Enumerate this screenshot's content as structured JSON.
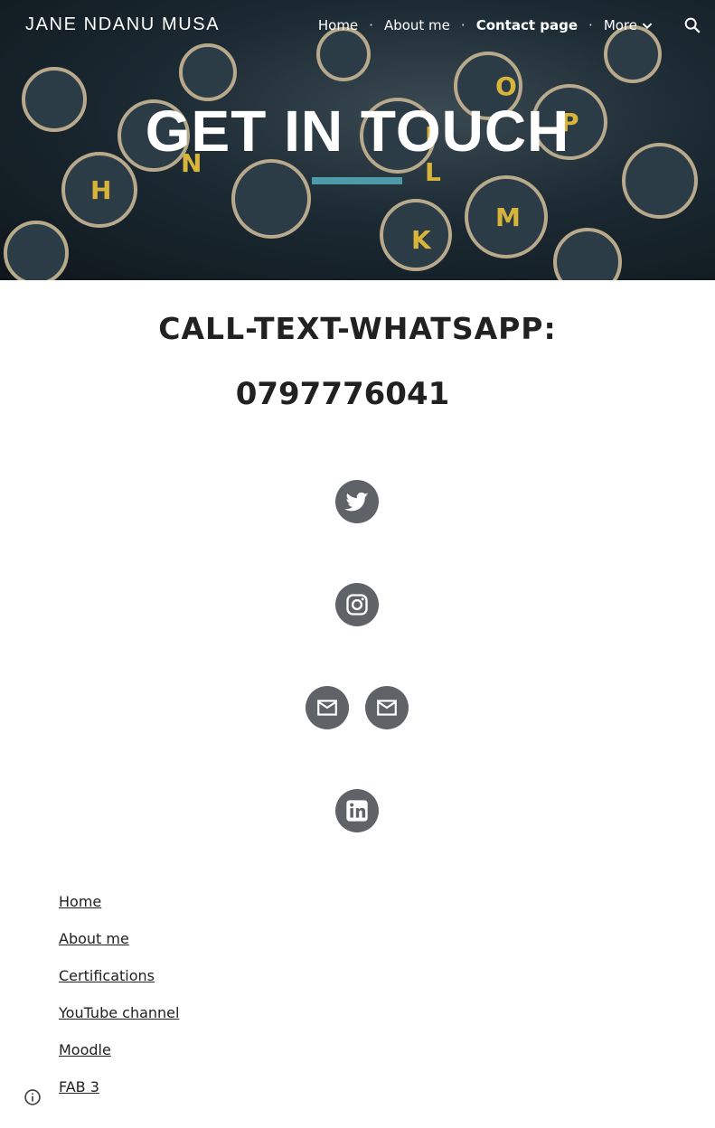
{
  "site": {
    "title": "JANE NDANU MUSA"
  },
  "nav": {
    "items": [
      {
        "label": "Home"
      },
      {
        "label": "About me"
      },
      {
        "label": "Contact page"
      },
      {
        "label": "More"
      }
    ],
    "separator": "·",
    "active_index": 2
  },
  "hero": {
    "title": "GET IN TOUCH",
    "accent_color": "#4f9aa8"
  },
  "content": {
    "call_text": "CALL-TEXT-WHATSAPP:",
    "phone": "0797776041"
  },
  "social": [
    {
      "icon": "twitter-icon"
    },
    {
      "icon": "instagram-icon"
    },
    {
      "icon": "email-icon"
    },
    {
      "icon": "email-icon"
    },
    {
      "icon": "linkedin-icon"
    }
  ],
  "footer": {
    "links": [
      {
        "label": "Home"
      },
      {
        "label": "About me "
      },
      {
        "label": "Certifications"
      },
      {
        "label": "YouTube channel"
      },
      {
        "label": "Moodle"
      },
      {
        "label": "FAB 3"
      }
    ]
  },
  "colors": {
    "icon_bg": "#5f6368",
    "text": "#212121"
  }
}
